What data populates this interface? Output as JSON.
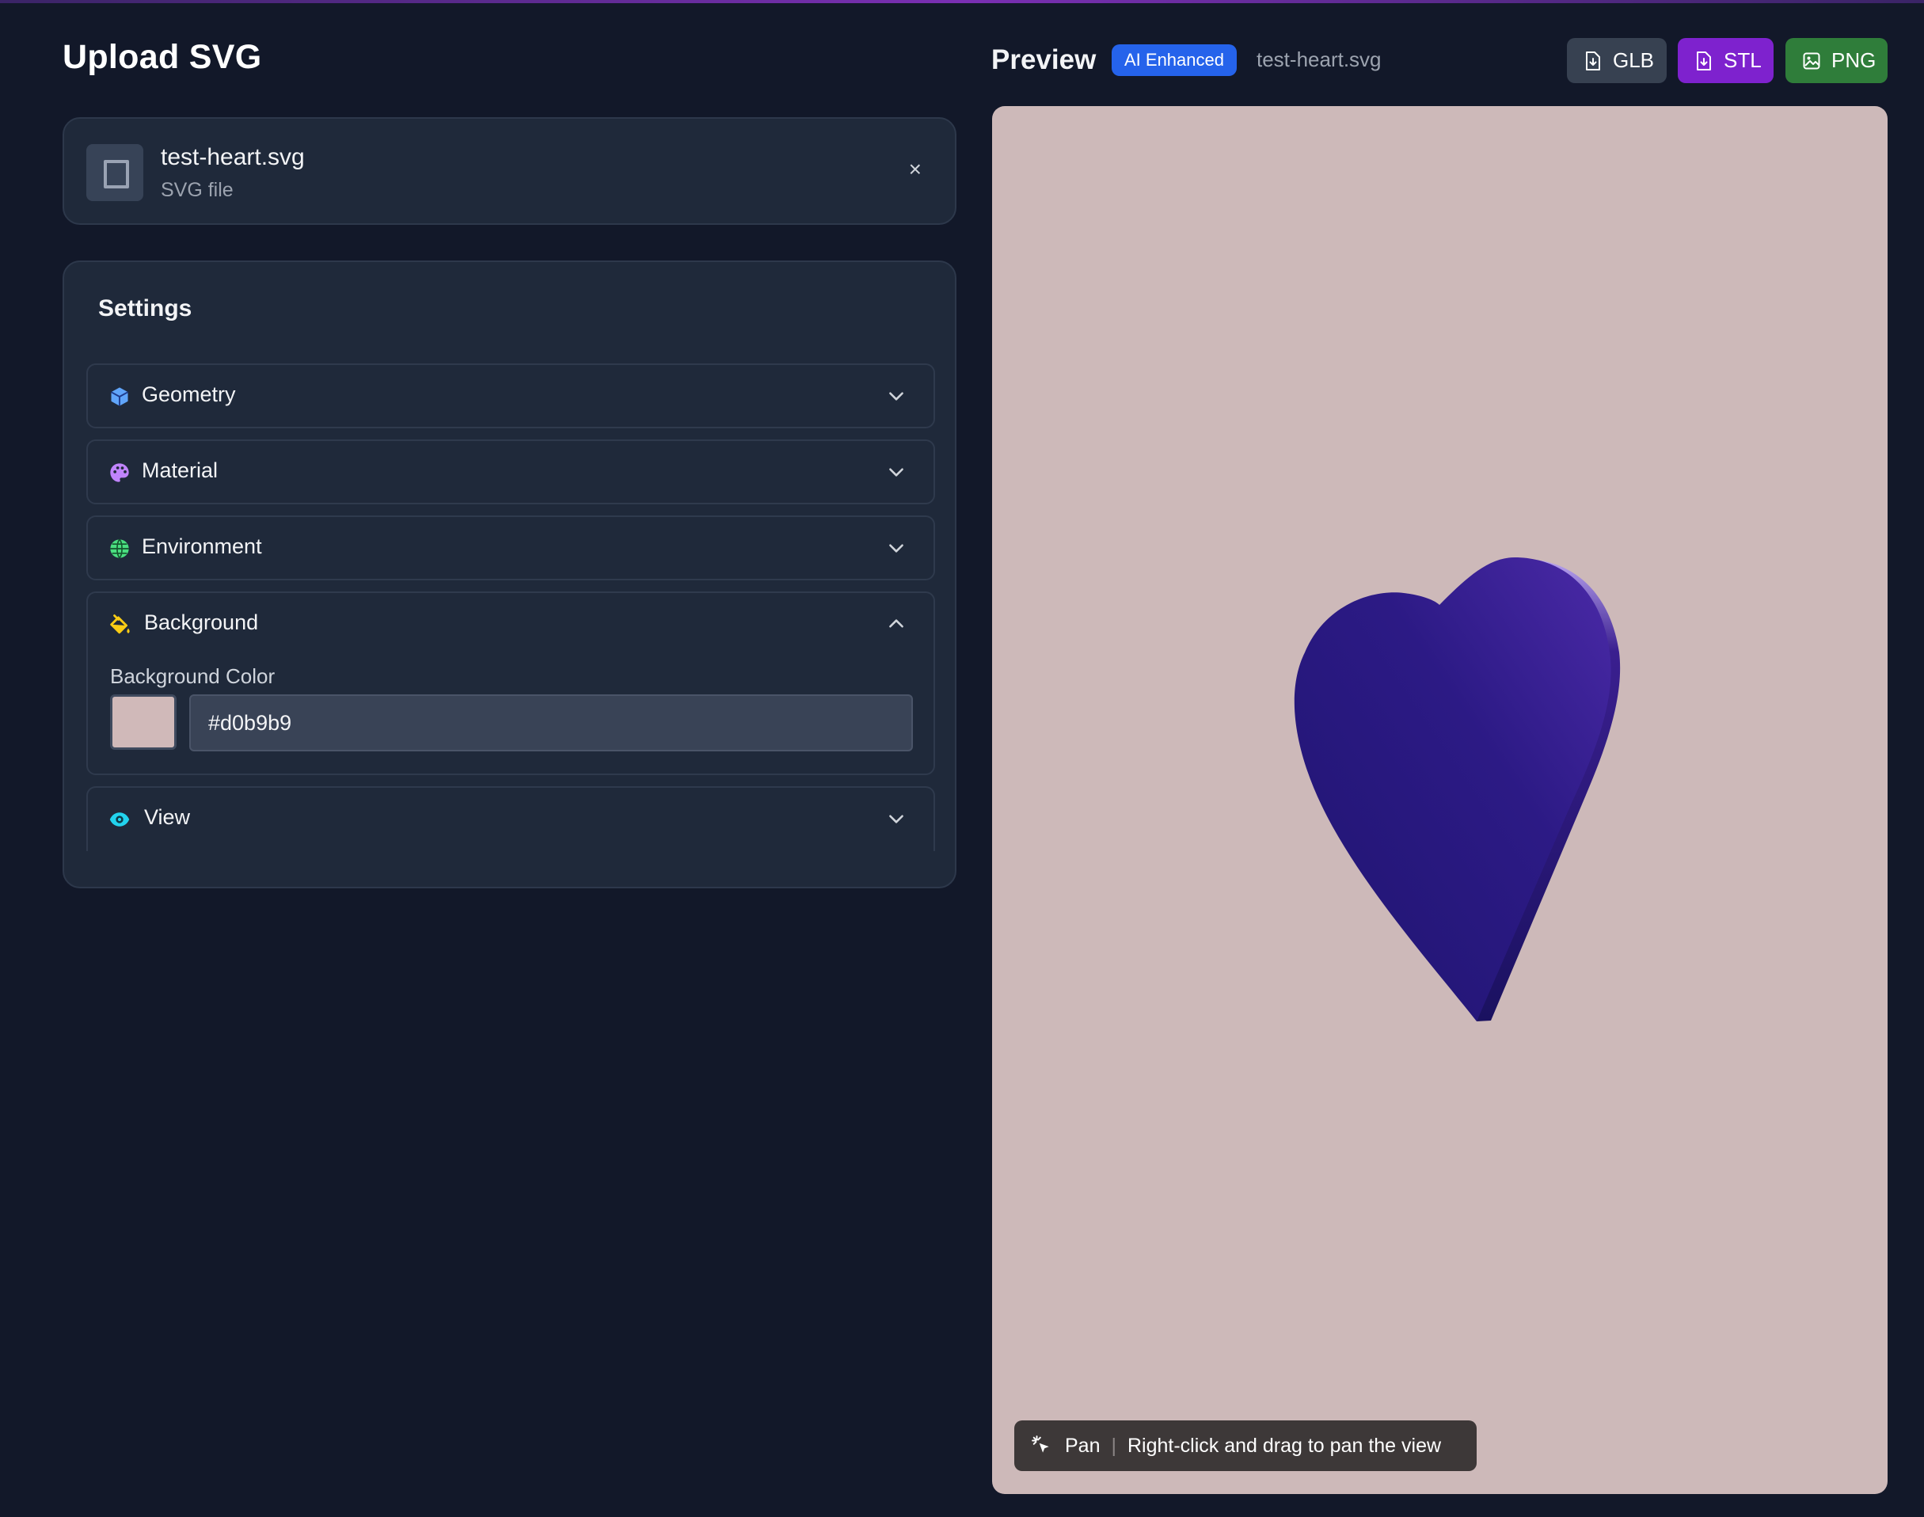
{
  "upload": {
    "title": "Upload SVG",
    "file": {
      "name": "test-heart.svg",
      "type": "SVG file",
      "close": "×"
    }
  },
  "settings": {
    "title": "Settings",
    "sections": [
      {
        "label": "Geometry",
        "icon": "cube-icon",
        "expanded": false
      },
      {
        "label": "Material",
        "icon": "palette-icon",
        "expanded": false
      },
      {
        "label": "Environment",
        "icon": "globe-icon",
        "expanded": false
      },
      {
        "label": "Background",
        "icon": "paint-bucket-icon",
        "expanded": true
      },
      {
        "label": "View",
        "icon": "eye-icon",
        "expanded": false
      }
    ],
    "background": {
      "color_label": "Background Color",
      "color_value": "#d0b9b9"
    }
  },
  "preview": {
    "title": "Preview",
    "badge": "AI Enhanced",
    "file_name": "test-heart.svg",
    "exports": [
      {
        "label": "GLB",
        "color": "#374151"
      },
      {
        "label": "STL",
        "color": "#7e22ce"
      },
      {
        "label": "PNG",
        "color": "#2f7d3a"
      }
    ],
    "hint": {
      "mode": "Pan",
      "separator": "|",
      "text": "Right-click and drag to pan the view"
    },
    "viewport_color": "#cdb9b9"
  },
  "colors": {
    "app_bg": "#121829",
    "panel_bg": "#1f293a",
    "accent_blue": "#2563eb"
  }
}
